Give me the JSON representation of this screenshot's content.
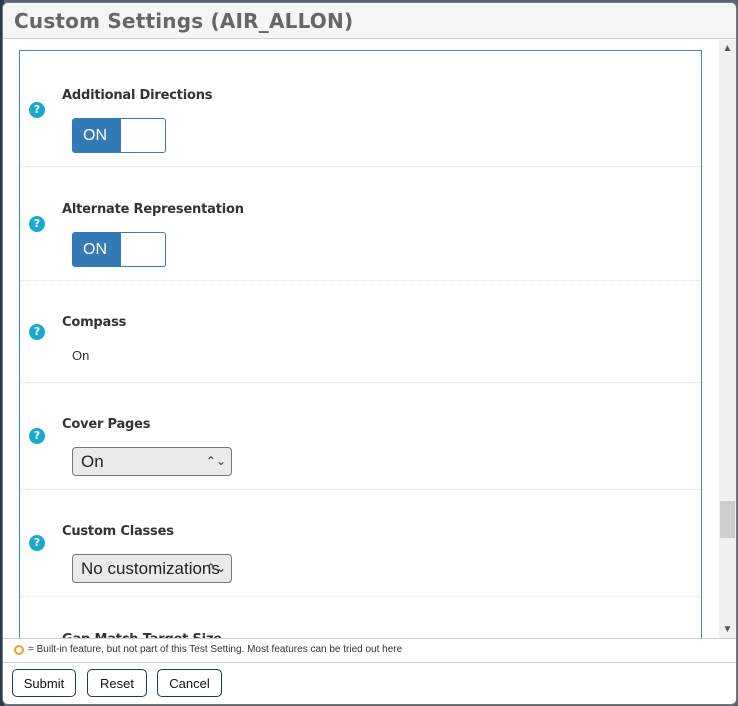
{
  "dialog": {
    "title": "Custom Settings (AIR_ALLON)"
  },
  "settings": [
    {
      "label": "Additional Directions",
      "control": "toggle",
      "value": "ON"
    },
    {
      "label": "Alternate Representation",
      "control": "toggle",
      "value": "ON"
    },
    {
      "label": "Compass",
      "control": "static",
      "value": "On"
    },
    {
      "label": "Cover Pages",
      "control": "select",
      "value": "On"
    },
    {
      "label": "Custom Classes",
      "control": "select",
      "value": "No customizations"
    },
    {
      "label": "Gap Match Target Size",
      "control": "unknown",
      "value": ""
    }
  ],
  "help_icon_glyph": "?",
  "select_arrows_glyph": "⌃⌄",
  "scrollbar": {
    "up_glyph": "⌃",
    "down_glyph": "⌄",
    "position_fraction": 0.82
  },
  "legend": {
    "icon": "built-in-feature-circle-icon",
    "icon_color": "#f0a020",
    "text": "= Built-in feature, but not part of this Test Setting. Most features can be tried out here"
  },
  "footer": {
    "submit_label": "Submit",
    "reset_label": "Reset",
    "cancel_label": "Cancel"
  },
  "colors": {
    "toggle_on": "#337ab7",
    "help_icon": "#1aa8cc",
    "panel_border": "#3b8fb0",
    "title_text": "#666666"
  }
}
